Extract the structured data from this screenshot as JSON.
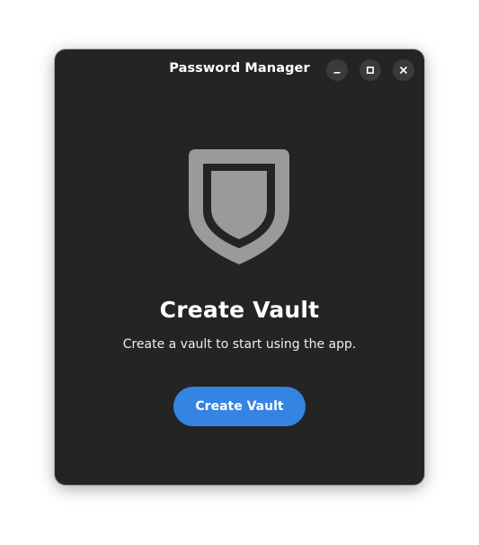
{
  "window": {
    "title": "Password Manager",
    "controls": {
      "minimize_icon": "minimize-icon",
      "maximize_icon": "maximize-icon",
      "close_icon": "close-icon"
    }
  },
  "empty_state": {
    "icon": "shield-icon",
    "heading": "Create Vault",
    "description": "Create a vault to start using the app.",
    "button_label": "Create Vault"
  },
  "colors": {
    "window_bg": "#242424",
    "accent": "#3584e4",
    "icon": "#9a9a9a",
    "text": "#ffffff"
  }
}
